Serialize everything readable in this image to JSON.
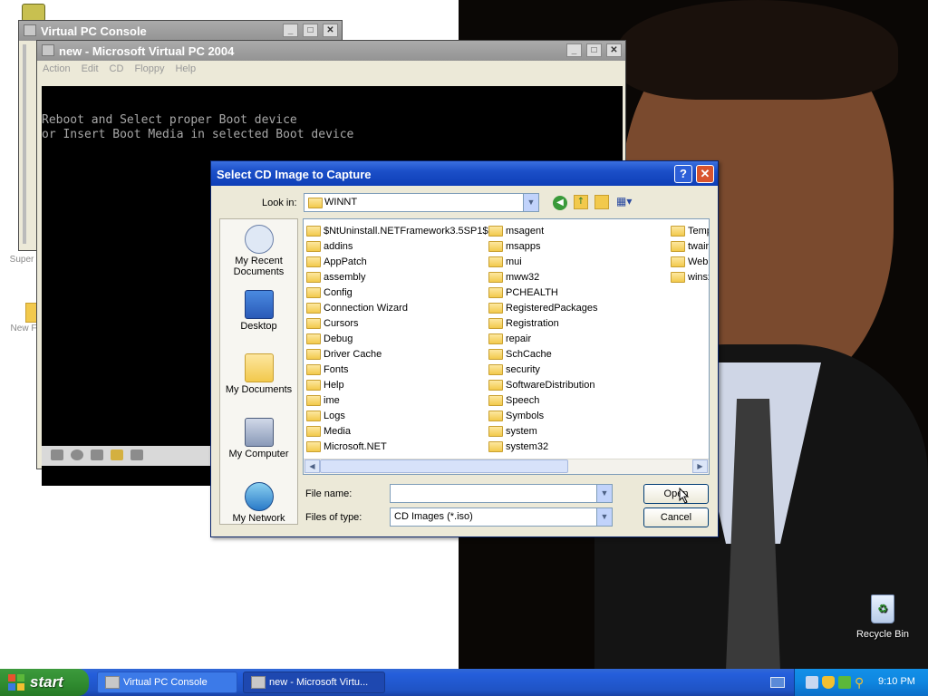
{
  "desktop": {
    "icons": [
      {
        "label": "Super"
      },
      {
        "label": "New F"
      },
      {
        "label": "Recycle Bin"
      }
    ]
  },
  "console_window": {
    "title": "Virtual PC Console"
  },
  "vm_window": {
    "title": "new - Microsoft Virtual PC 2004",
    "menu": [
      "Action",
      "Edit",
      "CD",
      "Floppy",
      "Help"
    ],
    "screen_lines": [
      "Reboot and Select proper Boot device",
      "or Insert Boot Media in selected Boot device"
    ]
  },
  "dialog": {
    "title": "Select CD Image to Capture",
    "help_glyph": "?",
    "close_glyph": "✕",
    "look_in_label": "Look in:",
    "look_in_value": "WINNT",
    "places": [
      {
        "label": "My Recent Documents",
        "icon": "recent-documents-icon"
      },
      {
        "label": "Desktop",
        "icon": "desktop-icon"
      },
      {
        "label": "My Documents",
        "icon": "my-documents-icon"
      },
      {
        "label": "My Computer",
        "icon": "my-computer-icon"
      },
      {
        "label": "My Network",
        "icon": "my-network-icon"
      }
    ],
    "folders_col1": [
      "$NtUninstall.NETFramework3.5SP1$",
      "addins",
      "AppPatch",
      "assembly",
      "Config",
      "Connection Wizard",
      "Cursors",
      "Debug",
      "Driver Cache",
      "Fonts",
      "Help",
      "ime",
      "Logs",
      "Media",
      "Microsoft.NET"
    ],
    "folders_col2": [
      "msagent",
      "msapps",
      "mui",
      "mww32",
      "PCHEALTH",
      "RegisteredPackages",
      "Registration",
      "repair",
      "SchCache",
      "security",
      "SoftwareDistribution",
      "Speech",
      "Symbols",
      "system",
      "system32"
    ],
    "folders_col3": [
      "Temp",
      "twain",
      "Web",
      "winsx"
    ],
    "file_name_label": "File name:",
    "file_name_value": "",
    "files_of_type_label": "Files of type:",
    "files_of_type_value": "CD Images (*.iso)",
    "open_label": "Open",
    "cancel_label": "Cancel"
  },
  "taskbar": {
    "start_label": "start",
    "items": [
      "Virtual PC Console",
      "new - Microsoft Virtu..."
    ],
    "clock": "9:10 PM"
  },
  "colors": {
    "dialog_title": "#0e3fb8",
    "taskbar": "#245edb",
    "start": "#2f8a2f",
    "tray": "#0f86e0"
  }
}
